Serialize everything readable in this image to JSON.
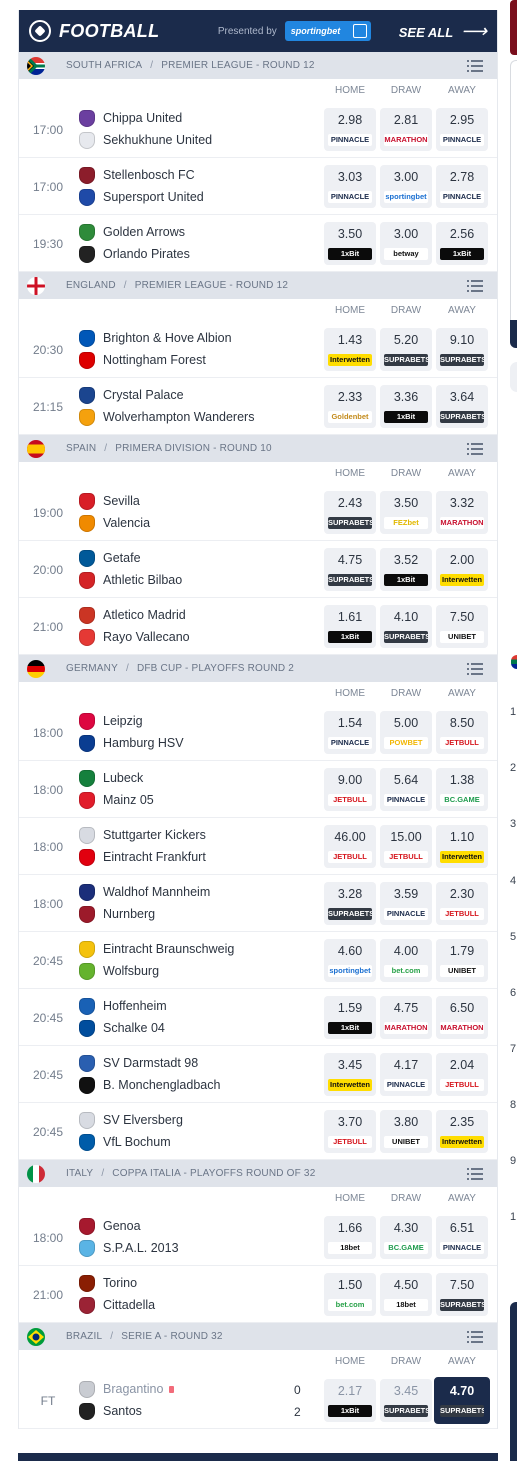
{
  "header": {
    "title": "FOOTBALL",
    "presented_by": "Presented by",
    "sponsor": "sportingbet",
    "see_all": "SEE ALL",
    "see_all_arrow": "⟶"
  },
  "columns": {
    "home": "HOME",
    "draw": "DRAW",
    "away": "AWAY"
  },
  "bookmakers": {
    "PINNACLE": {
      "bg": "#ffffff",
      "fg": "#1b2b4b"
    },
    "MARATHON": {
      "bg": "#ffffff",
      "fg": "#c8102e"
    },
    "sportingbet": {
      "bg": "#ffffff",
      "fg": "#1a6fd1"
    },
    "1xBit": {
      "bg": "#0b0b0b",
      "fg": "#ffffff"
    },
    "betway": {
      "bg": "#ffffff",
      "fg": "#111111"
    },
    "Interwetten": {
      "bg": "#ffdd00",
      "fg": "#111111"
    },
    "SUPRABETS": {
      "bg": "#333a44",
      "fg": "#ffffff"
    },
    "Goldenbet": {
      "bg": "#ffffff",
      "fg": "#c38b1c"
    },
    "FEZbet": {
      "bg": "#ffffff",
      "fg": "#e1b800"
    },
    "UNIBET": {
      "bg": "#ffffff",
      "fg": "#111111"
    },
    "POWBET": {
      "bg": "#ffffff",
      "fg": "#f2b705"
    },
    "JETBULL": {
      "bg": "#ffffff",
      "fg": "#d6171f"
    },
    "BC.GAME": {
      "bg": "#ffffff",
      "fg": "#1e9b4d"
    },
    "bet.com": {
      "bg": "#ffffff",
      "fg": "#27a148"
    },
    "18bet": {
      "bg": "#ffffff",
      "fg": "#111111"
    }
  },
  "leagues": [
    {
      "country": "SOUTH AFRICA",
      "competition": "PREMIER LEAGUE - ROUND 12",
      "flag": "za",
      "matches": [
        {
          "time": "17:00",
          "home": "Chippa United",
          "away": "Sekhukhune United",
          "hc": "#6b3fa0",
          "ac": "#e7e9ee",
          "odds": [
            {
              "v": "2.98",
              "b": "PINNACLE"
            },
            {
              "v": "2.81",
              "b": "MARATHON"
            },
            {
              "v": "2.95",
              "b": "PINNACLE"
            }
          ]
        },
        {
          "time": "17:00",
          "home": "Stellenbosch FC",
          "away": "Supersport United",
          "hc": "#8c1d2b",
          "ac": "#1f4aa8",
          "odds": [
            {
              "v": "3.03",
              "b": "PINNACLE"
            },
            {
              "v": "3.00",
              "b": "sportingbet"
            },
            {
              "v": "2.78",
              "b": "PINNACLE"
            }
          ]
        },
        {
          "time": "19:30",
          "home": "Golden Arrows",
          "away": "Orlando Pirates",
          "hc": "#2e8b3a",
          "ac": "#222222",
          "odds": [
            {
              "v": "3.50",
              "b": "1xBit"
            },
            {
              "v": "3.00",
              "b": "betway"
            },
            {
              "v": "2.56",
              "b": "1xBit"
            }
          ]
        }
      ]
    },
    {
      "country": "ENGLAND",
      "competition": "PREMIER LEAGUE - ROUND 12",
      "flag": "en",
      "matches": [
        {
          "time": "20:30",
          "home": "Brighton & Hove Albion",
          "away": "Nottingham Forest",
          "hc": "#0057b8",
          "ac": "#dd0000",
          "odds": [
            {
              "v": "1.43",
              "b": "Interwetten"
            },
            {
              "v": "5.20",
              "b": "SUPRABETS"
            },
            {
              "v": "9.10",
              "b": "SUPRABETS"
            }
          ]
        },
        {
          "time": "21:15",
          "home": "Crystal Palace",
          "away": "Wolverhampton Wanderers",
          "hc": "#1b458f",
          "ac": "#f5a10d",
          "odds": [
            {
              "v": "2.33",
              "b": "Goldenbet"
            },
            {
              "v": "3.36",
              "b": "1xBit"
            },
            {
              "v": "3.64",
              "b": "SUPRABETS"
            }
          ]
        }
      ]
    },
    {
      "country": "SPAIN",
      "competition": "PRIMERA DIVISION - ROUND 10",
      "flag": "es",
      "matches": [
        {
          "time": "19:00",
          "home": "Sevilla",
          "away": "Valencia",
          "hc": "#d81e27",
          "ac": "#f08a00",
          "odds": [
            {
              "v": "2.43",
              "b": "SUPRABETS"
            },
            {
              "v": "3.50",
              "b": "FEZbet"
            },
            {
              "v": "3.32",
              "b": "MARATHON"
            }
          ]
        },
        {
          "time": "20:00",
          "home": "Getafe",
          "away": "Athletic Bilbao",
          "hc": "#005999",
          "ac": "#d42427",
          "odds": [
            {
              "v": "4.75",
              "b": "SUPRABETS"
            },
            {
              "v": "3.52",
              "b": "1xBit"
            },
            {
              "v": "2.00",
              "b": "Interwetten"
            }
          ]
        },
        {
          "time": "21:00",
          "home": "Atletico Madrid",
          "away": "Rayo Vallecano",
          "hc": "#cb3524",
          "ac": "#e53935",
          "odds": [
            {
              "v": "1.61",
              "b": "1xBit"
            },
            {
              "v": "4.10",
              "b": "SUPRABETS"
            },
            {
              "v": "7.50",
              "b": "UNIBET"
            }
          ]
        }
      ]
    },
    {
      "country": "GERMANY",
      "competition": "DFB CUP - PLAYOFFS ROUND 2",
      "flag": "de",
      "matches": [
        {
          "time": "18:00",
          "home": "Leipzig",
          "away": "Hamburg HSV",
          "hc": "#dd0741",
          "ac": "#0a3d91",
          "odds": [
            {
              "v": "1.54",
              "b": "PINNACLE"
            },
            {
              "v": "5.00",
              "b": "POWBET"
            },
            {
              "v": "8.50",
              "b": "JETBULL"
            }
          ]
        },
        {
          "time": "18:00",
          "home": "Lubeck",
          "away": "Mainz 05",
          "hc": "#15803d",
          "ac": "#e11d2b",
          "odds": [
            {
              "v": "9.00",
              "b": "JETBULL"
            },
            {
              "v": "5.64",
              "b": "PINNACLE"
            },
            {
              "v": "1.38",
              "b": "BC.GAME"
            }
          ]
        },
        {
          "time": "18:00",
          "home": "Stuttgarter Kickers",
          "away": "Eintracht Frankfurt",
          "hc": "#d8dbe2",
          "ac": "#e1000f",
          "odds": [
            {
              "v": "46.00",
              "b": "JETBULL"
            },
            {
              "v": "15.00",
              "b": "JETBULL"
            },
            {
              "v": "1.10",
              "b": "Interwetten"
            }
          ]
        },
        {
          "time": "18:00",
          "home": "Waldhof Mannheim",
          "away": "Nurnberg",
          "hc": "#1b2e7a",
          "ac": "#9c1a2a",
          "odds": [
            {
              "v": "3.28",
              "b": "SUPRABETS"
            },
            {
              "v": "3.59",
              "b": "PINNACLE"
            },
            {
              "v": "2.30",
              "b": "JETBULL"
            }
          ]
        },
        {
          "time": "20:45",
          "home": "Eintracht Braunschweig",
          "away": "Wolfsburg",
          "hc": "#f4c20d",
          "ac": "#65b32e",
          "odds": [
            {
              "v": "4.60",
              "b": "sportingbet"
            },
            {
              "v": "4.00",
              "b": "bet.com"
            },
            {
              "v": "1.79",
              "b": "UNIBET"
            }
          ]
        },
        {
          "time": "20:45",
          "home": "Hoffenheim",
          "away": "Schalke 04",
          "hc": "#1961b5",
          "ac": "#004d9d",
          "odds": [
            {
              "v": "1.59",
              "b": "1xBit"
            },
            {
              "v": "4.75",
              "b": "MARATHON"
            },
            {
              "v": "6.50",
              "b": "MARATHON"
            }
          ]
        },
        {
          "time": "20:45",
          "home": "SV Darmstadt 98",
          "away": "B. Monchengladbach",
          "hc": "#2a5fb0",
          "ac": "#111111",
          "odds": [
            {
              "v": "3.45",
              "b": "Interwetten"
            },
            {
              "v": "4.17",
              "b": "PINNACLE"
            },
            {
              "v": "2.04",
              "b": "JETBULL"
            }
          ]
        },
        {
          "time": "20:45",
          "home": "SV Elversberg",
          "away": "VfL Bochum",
          "hc": "#d8dbe2",
          "ac": "#005ca9",
          "odds": [
            {
              "v": "3.70",
              "b": "JETBULL"
            },
            {
              "v": "3.80",
              "b": "UNIBET"
            },
            {
              "v": "2.35",
              "b": "Interwetten"
            }
          ]
        }
      ]
    },
    {
      "country": "ITALY",
      "competition": "COPPA ITALIA - PLAYOFFS ROUND OF 32",
      "flag": "it",
      "matches": [
        {
          "time": "18:00",
          "home": "Genoa",
          "away": "S.P.A.L. 2013",
          "hc": "#a6192e",
          "ac": "#5ab4e5",
          "odds": [
            {
              "v": "1.66",
              "b": "18bet"
            },
            {
              "v": "4.30",
              "b": "BC.GAME"
            },
            {
              "v": "6.51",
              "b": "PINNACLE"
            }
          ]
        },
        {
          "time": "21:00",
          "home": "Torino",
          "away": "Cittadella",
          "hc": "#8a1e03",
          "ac": "#9b2335",
          "odds": [
            {
              "v": "1.50",
              "b": "bet.com"
            },
            {
              "v": "4.50",
              "b": "18bet"
            },
            {
              "v": "7.50",
              "b": "SUPRABETS"
            }
          ]
        }
      ]
    },
    {
      "country": "BRAZIL",
      "competition": "SERIE A - ROUND 32",
      "flag": "br",
      "matches": [
        {
          "time": "FT",
          "home": "Bragantino",
          "away": "Santos",
          "hc": "#c9ccd2",
          "ac": "#222222",
          "home_score": "0",
          "away_score": "2",
          "finished": true,
          "odds": [
            {
              "v": "2.17",
              "b": "1xBit"
            },
            {
              "v": "3.45",
              "b": "SUPRABETS"
            },
            {
              "v": "4.70",
              "b": "SUPRABETS",
              "winner": true
            }
          ]
        }
      ]
    }
  ],
  "sidebar_numbers": [
    "1",
    "2",
    "3",
    "4",
    "5",
    "6",
    "7",
    "8",
    "9",
    "1"
  ]
}
